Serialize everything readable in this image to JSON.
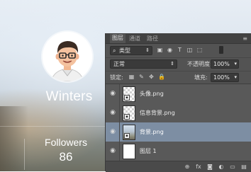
{
  "profile": {
    "name": "Winters",
    "followers_label": "Followers",
    "followers_count": "86"
  },
  "panel": {
    "tabs": [
      {
        "label": "图层",
        "active": true
      },
      {
        "label": "通道",
        "active": false
      },
      {
        "label": "路径",
        "active": false
      }
    ],
    "menu_icon": "≡",
    "filter": {
      "search_icon": "⌕",
      "label": "类型",
      "caret": "⇕"
    },
    "filter_buttons": [
      "▣",
      "◉",
      "T",
      "◫",
      "⬚"
    ],
    "blend_mode": {
      "label": "正常",
      "caret": "⇕"
    },
    "opacity": {
      "label": "不透明度:",
      "value": "100%",
      "caret": "▾"
    },
    "lock": {
      "label": "锁定:",
      "icons": [
        "▦",
        "✎",
        "✥",
        "🔒"
      ]
    },
    "fill": {
      "label": "填充:",
      "value": "100%",
      "caret": "▾"
    },
    "layers": [
      {
        "name": "头像.png",
        "thumb": "checker",
        "selected": false
      },
      {
        "name": "信息背景.png",
        "thumb": "checker",
        "selected": false
      },
      {
        "name": "背景.png",
        "thumb": "photo",
        "selected": true
      },
      {
        "name": "图层 1",
        "thumb": "white",
        "selected": false
      }
    ],
    "footer_icons": [
      "⊕",
      "fx",
      "◙",
      "◐",
      "▭",
      "▤"
    ]
  },
  "icons": {
    "eye": "eye-icon",
    "smart_object": "smart-object-icon"
  },
  "colors": {
    "panel_bg": "#535353",
    "selected_layer": "#7d8ea3",
    "avatar_bg": "#ffffff"
  }
}
